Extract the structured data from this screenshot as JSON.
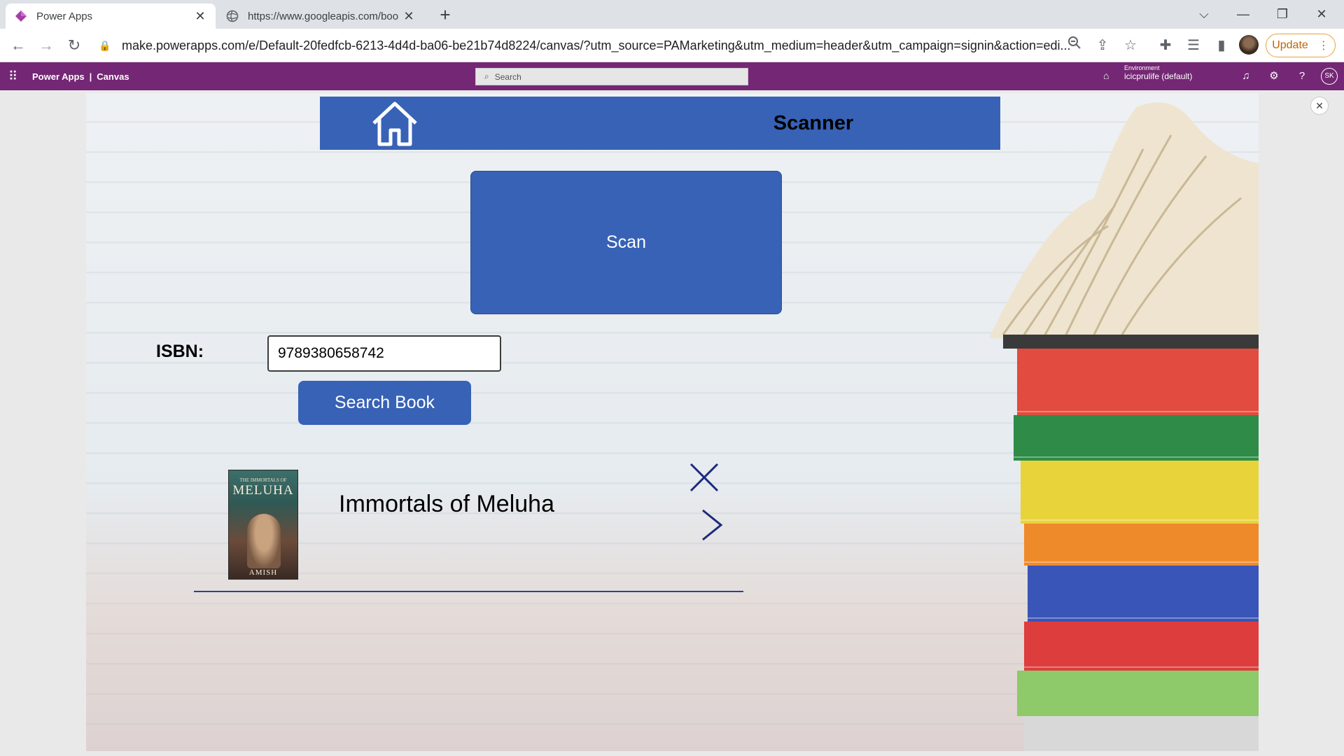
{
  "browser": {
    "tabs": [
      {
        "title": "Power Apps",
        "favicon": "power-apps-icon"
      },
      {
        "title": "https://www.googleapis.com/boo",
        "favicon": "globe-icon"
      }
    ],
    "new_tab_label": "+",
    "url": "make.powerapps.com/e/Default-20fedfcb-6213-4d4d-ba06-be21b74d8224/canvas/?utm_source=PAMarketing&utm_medium=header&utm_campaign=signin&action=edi...",
    "update_label": "Update"
  },
  "powerapps_header": {
    "brand": "Power Apps",
    "separator": "|",
    "section": "Canvas",
    "search_placeholder": "Search",
    "environment_label": "Environment",
    "environment_name": "icicprulife (default)",
    "user_initials": "SK"
  },
  "app": {
    "screen_title": "Scanner",
    "scan_label": "Scan",
    "isbn_label": "ISBN:",
    "isbn_value": "9789380658742",
    "search_book_label": "Search Book",
    "result": {
      "title": "Immortals of Meluha",
      "cover": {
        "top_text": "THE IMMORTALS OF",
        "title_text": "MELUHA",
        "author_text": "AMISH"
      }
    }
  },
  "colors": {
    "accent": "#3762b5",
    "powerapps_purple": "#742774",
    "separator": "#2e3f8f"
  }
}
